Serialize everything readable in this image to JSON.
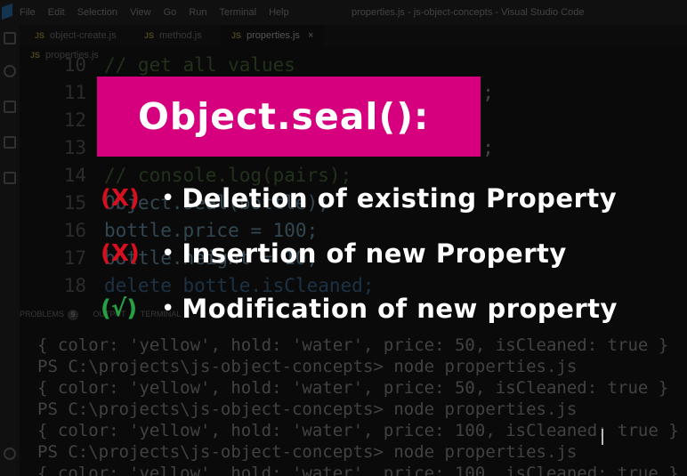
{
  "window": {
    "title": "properties.js - js-object-concepts - Visual Studio Code",
    "menu": [
      "File",
      "Edit",
      "Selection",
      "View",
      "Go",
      "Run",
      "Terminal",
      "Help"
    ]
  },
  "tabs": [
    {
      "label": "object-create.js",
      "badge": "JS",
      "active": false
    },
    {
      "label": "method.js",
      "badge": "JS",
      "active": false
    },
    {
      "label": "properties.js",
      "badge": "JS",
      "active": true,
      "close": "×"
    }
  ],
  "breadcrumb": {
    "badge": "JS",
    "file": "properties.js"
  },
  "editor": {
    "lines": [
      {
        "num": "10",
        "text": "// get all values",
        "kind": "comment"
      },
      {
        "num": "11",
        "text": "e);",
        "kind": "plain"
      },
      {
        "num": "12",
        "text": "",
        "kind": "plain"
      },
      {
        "num": "13",
        "text": "e);",
        "kind": "plain"
      },
      {
        "num": "14",
        "text": "// console.log(pairs);",
        "kind": "comment"
      },
      {
        "num": "15",
        "text": "Object.seal(bottle);",
        "kind": "plain"
      },
      {
        "num": "16",
        "text": "bottle.price = 100;",
        "kind": "assign"
      },
      {
        "num": "17",
        "text": "bottle.height = 10;",
        "kind": "assign"
      },
      {
        "num": "18",
        "text": "delete bottle.isCleaned;",
        "kind": "delete"
      }
    ]
  },
  "panel": {
    "problems": "PROBLEMS",
    "problems_count": "9",
    "output": "OUTPUT",
    "terminal": "TERMINAL"
  },
  "terminal": {
    "lines": [
      "{ color: 'yellow', hold: 'water', price: 50, isCleaned: true }",
      "PS C:\\projects\\js-object-concepts> node properties.js",
      "{ color: 'yellow', hold: 'water', price: 50, isCleaned: true }",
      "PS C:\\projects\\js-object-concepts> node properties.js",
      "{ color: 'yellow', hold: 'water', price: 100, isCleaned: true }",
      "PS C:\\projects\\js-object-concepts> node properties.js",
      "{ color: 'yellow', hold: 'water', price: 100, isCleaned: true }"
    ]
  },
  "overlay": {
    "title": "Object.seal():",
    "accent": "#d6007e",
    "bullet": "•",
    "rules": [
      {
        "mark": "(X)",
        "status": "not-allowed",
        "color": "#d6101e",
        "text": "Deletion of existing Property"
      },
      {
        "mark": "(X)",
        "status": "not-allowed",
        "color": "#d6101e",
        "text": "Insertion of new Property"
      },
      {
        "mark": "(√)",
        "status": "allowed",
        "color": "#27a043",
        "text": "Modification of new property"
      }
    ]
  }
}
